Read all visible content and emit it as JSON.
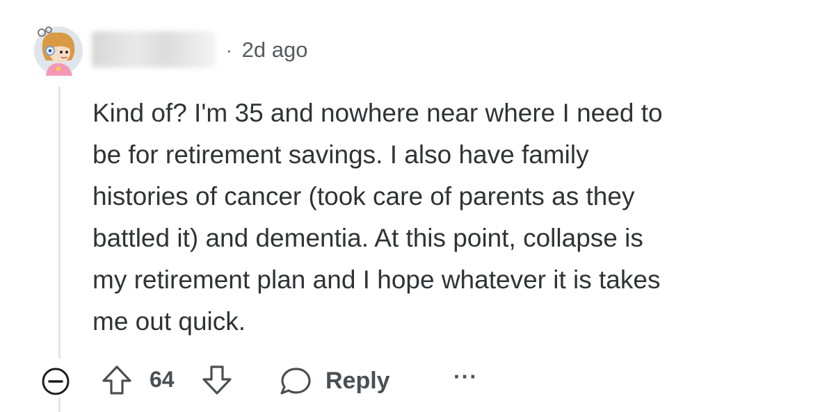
{
  "comment": {
    "timestamp_separator": "·",
    "timestamp": "2d ago",
    "body_lines": [
      "Kind of? I'm 35 and nowhere near where I need to",
      "be for retirement savings. I also have family",
      "histories of cancer (took care of parents as they",
      "battled it) and dementia. At this point, collapse is",
      "my retirement plan and I hope whatever it is takes",
      "me out quick."
    ]
  },
  "actions": {
    "vote_count": "64",
    "reply_label": "Reply",
    "more_label": "···",
    "icons": {
      "collapse": "collapse-minus-icon",
      "upvote": "upvote-arrow-icon",
      "downvote": "downvote-arrow-icon",
      "reply": "speech-bubble-icon",
      "more": "more-dots-icon"
    }
  },
  "colors": {
    "text": "#303336",
    "meta": "#555a5e",
    "icon": "#4a4f53",
    "thread_line": "#e1e3e5"
  }
}
